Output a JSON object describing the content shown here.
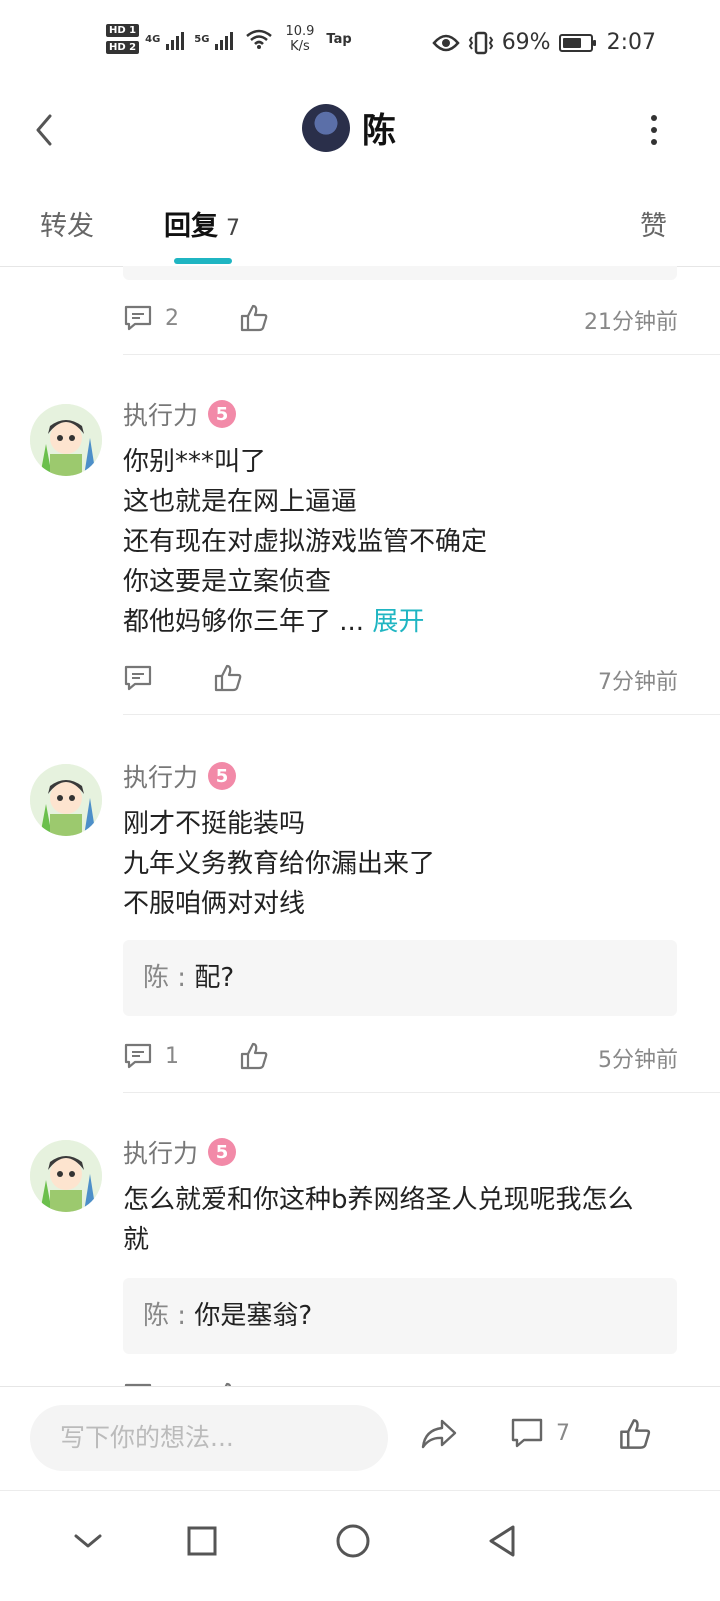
{
  "status_bar": {
    "hd1": "HD 1",
    "hd2": "HD 2",
    "net_4g": "4G",
    "net_5g": "5G",
    "speed_value": "10.9",
    "speed_unit": "K/s",
    "app_tag": "Tap",
    "battery": "69%",
    "battery_level": 0.69,
    "time": "2:07"
  },
  "header": {
    "title": "陈"
  },
  "tabs": [
    {
      "label": "转发",
      "count": ""
    },
    {
      "label": "回复",
      "count": "7"
    },
    {
      "label": "赞",
      "count": ""
    }
  ],
  "top_item": {
    "comment_count": "2",
    "time": "21分钟前"
  },
  "comments": [
    {
      "author": "执行力",
      "badge": "5",
      "lines": [
        "你别***叫了",
        "这也就是在网上逼逼",
        "还有现在对虚拟游戏监管不确定",
        "你这要是立案侦查",
        "都他妈够你三年了 ..."
      ],
      "expand_label": "展开",
      "comment_count": "",
      "time": "7分钟前"
    },
    {
      "author": "执行力",
      "badge": "5",
      "lines": [
        "刚才不挺能装吗",
        "九年义务教育给你漏出来了",
        "不服咱俩对对线"
      ],
      "reply_name": "陈",
      "reply_text": "配?",
      "comment_count": "1",
      "time": "5分钟前"
    },
    {
      "author": "执行力",
      "badge": "5",
      "lines": [
        "怎么就爱和你这种b养网络圣人兑现呢我怎么",
        "就"
      ],
      "reply_name": "陈",
      "reply_text": "你是塞翁?"
    }
  ],
  "bottom_bar": {
    "placeholder": "写下你的想法...",
    "comment_count": "7"
  }
}
